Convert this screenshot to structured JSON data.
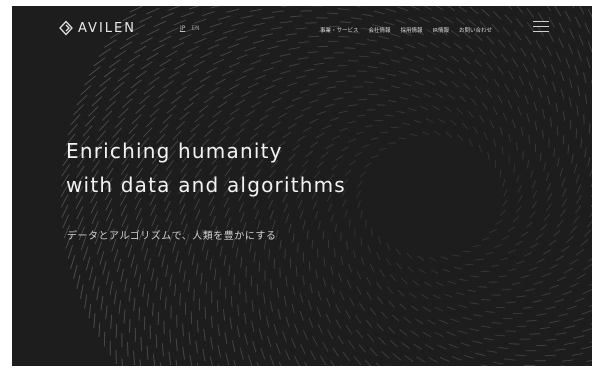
{
  "brand": {
    "name": "AVILEN",
    "logo_icon": "avilen-logo-mark"
  },
  "language": {
    "options": [
      "JP",
      "EN"
    ],
    "selected": "JP"
  },
  "nav": {
    "items": [
      "事業・サービス",
      "会社情報",
      "採用情報",
      "IR情報",
      "お問い合わせ"
    ],
    "menu_icon": "hamburger-menu-icon"
  },
  "hero": {
    "title_line1": "Enriching humanity",
    "title_line2": "with data and algorithms",
    "subtitle": "データとアルゴリズムで、人類を豊かにする"
  },
  "colors": {
    "background": "#1d1d1d",
    "text": "#f2f2f2",
    "pattern": "#6a6a6a"
  }
}
